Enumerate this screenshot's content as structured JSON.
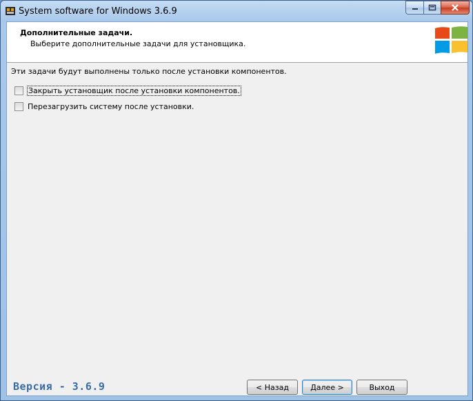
{
  "window": {
    "title": "System software for Windows 3.6.9"
  },
  "header": {
    "title": "Дополнительные задачи.",
    "subtitle": "Выберите дополнительные задачи для установщика."
  },
  "main": {
    "intro": "Эти задачи будут выполнены только после установки компонентов.",
    "tasks": [
      {
        "label": "Закрыть установщик после установки компонентов.",
        "checked": false
      },
      {
        "label": "Перезагрузить систему после установки.",
        "checked": false
      }
    ]
  },
  "footer": {
    "version": "Версия - 3.6.9",
    "back_label": "< Назад",
    "next_label": "Далее >",
    "exit_label": "Выход"
  },
  "colors": {
    "logo_red": "#e64a19",
    "logo_green": "#7cb342",
    "logo_blue": "#039be5",
    "logo_yellow": "#fbc02d",
    "version_text": "#3a6ca8"
  },
  "icons": [
    "installer-app-icon",
    "minimize-icon",
    "maximize-icon",
    "close-icon",
    "windows-logo-icon"
  ]
}
